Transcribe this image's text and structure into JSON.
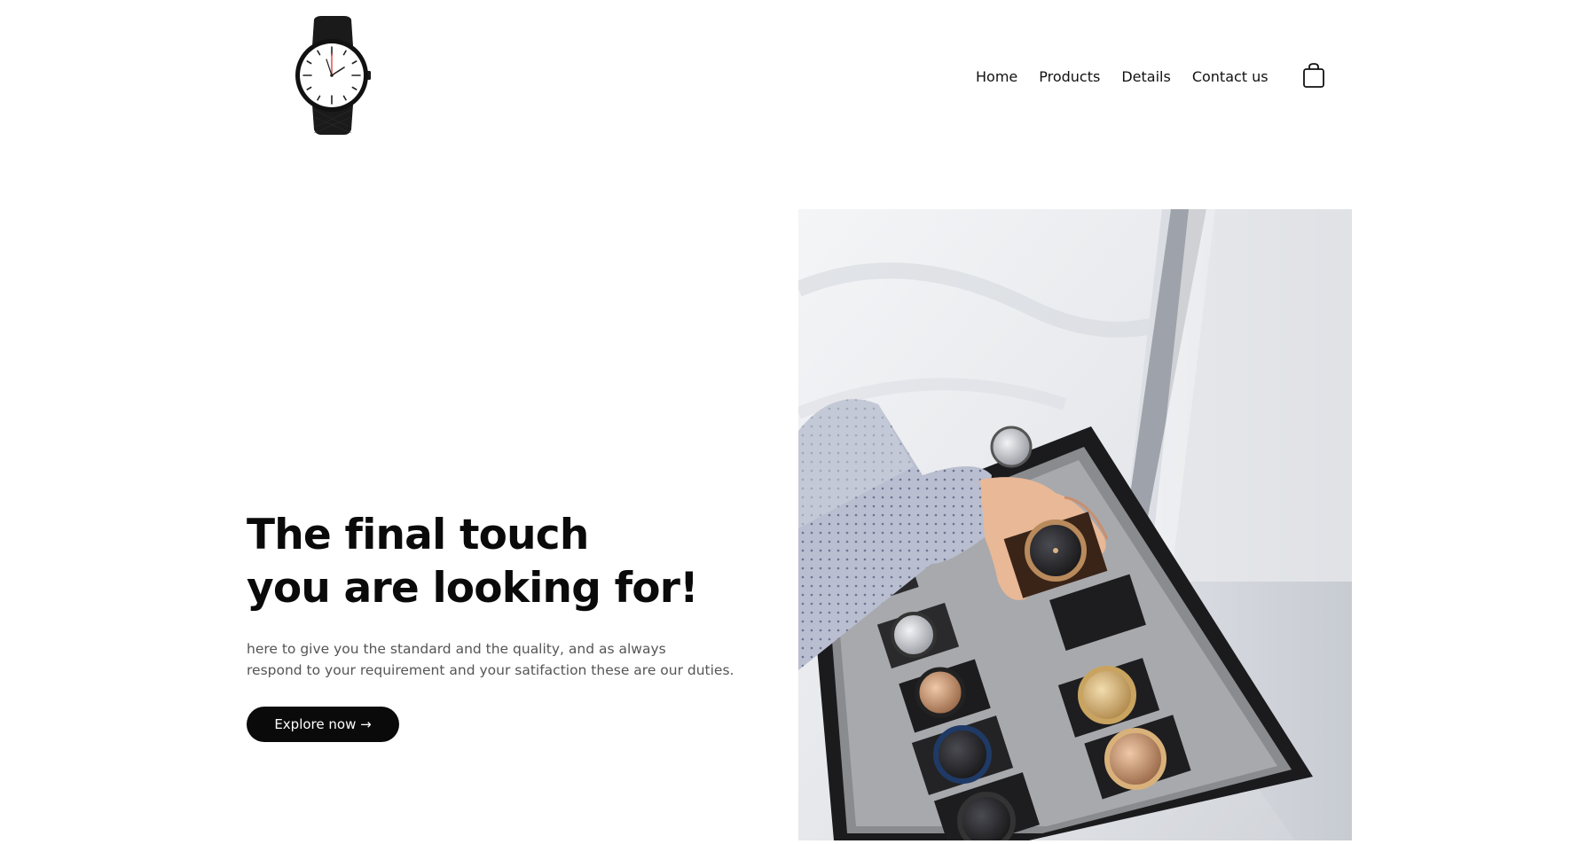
{
  "header": {
    "logo_icon": "wristwatch-logo-icon",
    "nav": [
      {
        "label": "Home"
      },
      {
        "label": "Products"
      },
      {
        "label": "Details"
      },
      {
        "label": "Contact us"
      }
    ],
    "cart_icon": "shopping-bag-icon"
  },
  "hero": {
    "title_line1": "The final touch",
    "title_line2": "you are looking for!",
    "description_line1": "here to give you the standard and the quality, and as always",
    "description_line2": "respond to your requirement and your satifaction these are our duties.",
    "cta_label": "Explore now →",
    "image_subject": "hand-picking-watch-from-display-case"
  },
  "colors": {
    "background": "#ffffff",
    "text": "#0a0a0a",
    "muted_text": "#555555",
    "button_bg": "#0a0a0a",
    "button_text": "#ffffff"
  }
}
